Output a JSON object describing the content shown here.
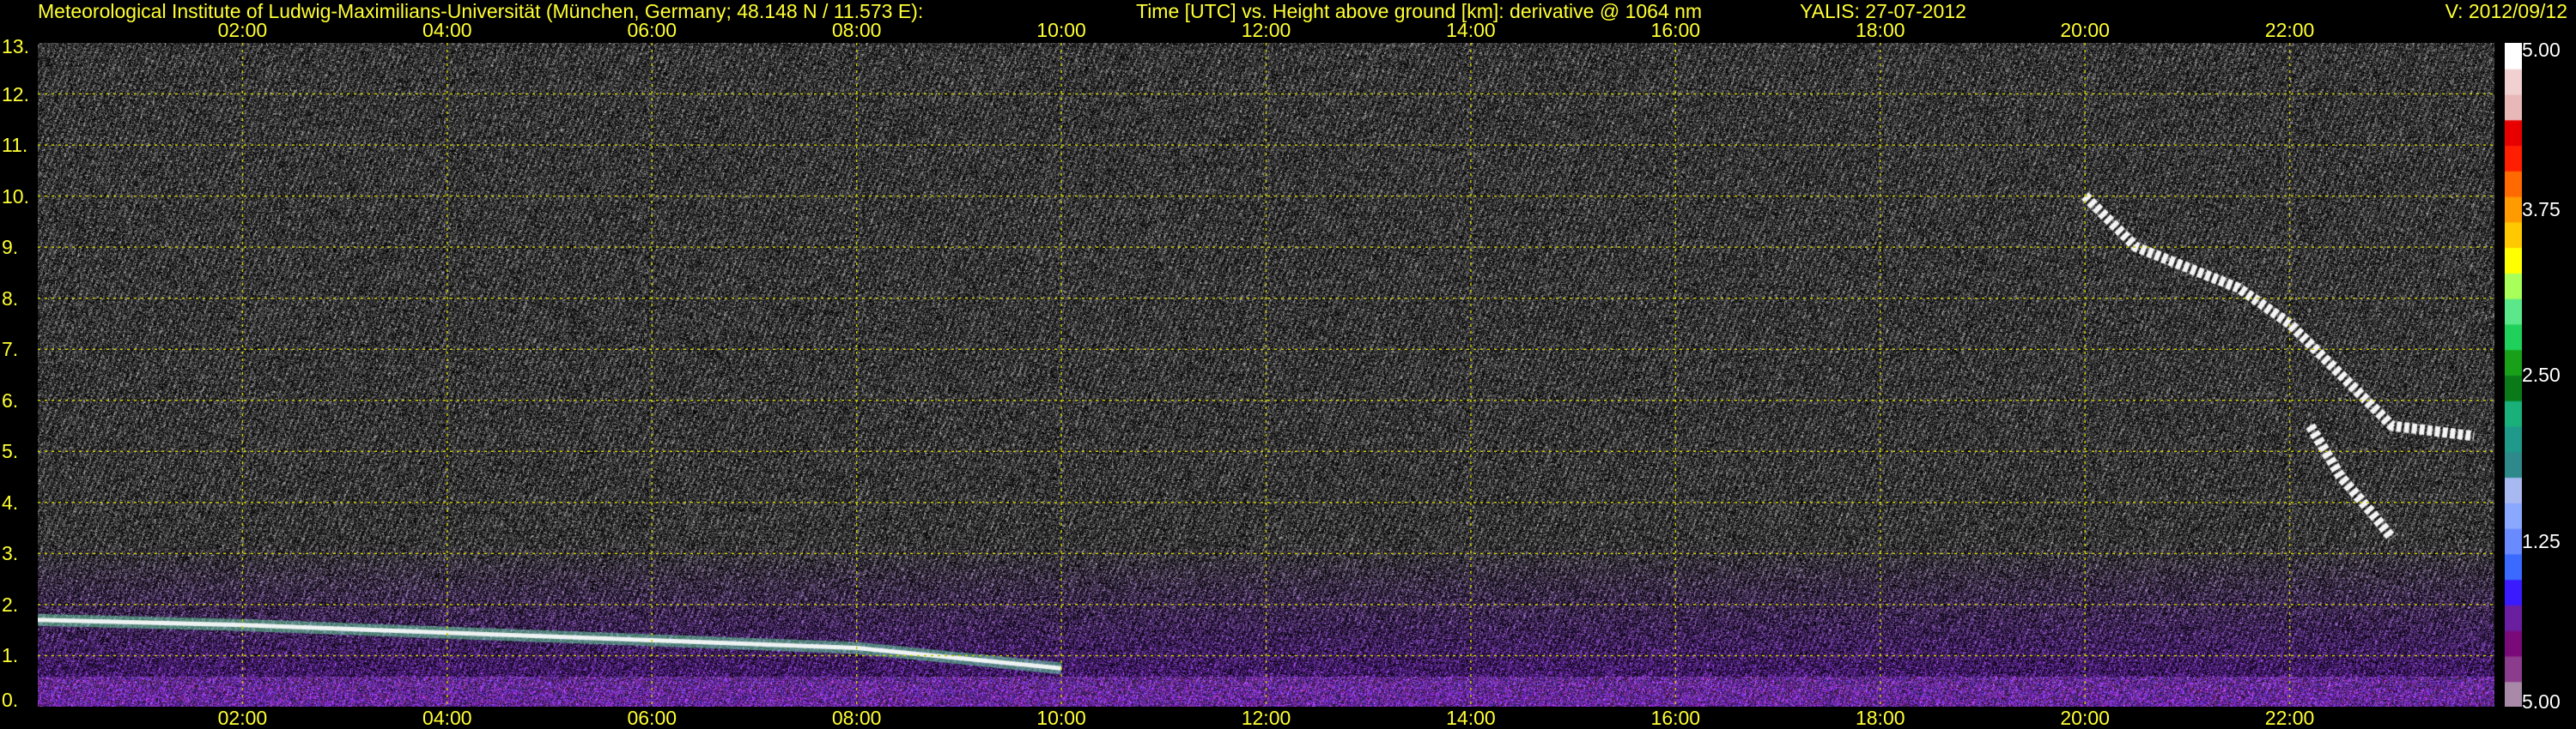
{
  "header": {
    "institute": "Meteorological Institute of Ludwig-Maximilians-Universität (München, Germany; 48.148 N / 11.573 E):",
    "title": "Time [UTC] vs. Height above ground [km]: derivative @ 1064 nm",
    "instrument": "YALIS: 27-07-2012",
    "version": "V: 2012/09/12"
  },
  "colors": {
    "text": "#ffff33",
    "grid": "#c8c800",
    "background": "#000000"
  },
  "chart_data": {
    "type": "heatmap",
    "title": "Time [UTC] vs. Height above ground [km]: derivative @ 1064 nm",
    "xlabel": "Time [UTC]",
    "ylabel": "Height above ground [km]",
    "xlim": [
      0,
      24
    ],
    "ylim": [
      0,
      13
    ],
    "x_ticks": [
      "02:00",
      "04:00",
      "06:00",
      "08:00",
      "10:00",
      "12:00",
      "14:00",
      "16:00",
      "18:00",
      "20:00",
      "22:00"
    ],
    "x_tick_values": [
      2,
      4,
      6,
      8,
      10,
      12,
      14,
      16,
      18,
      20,
      22
    ],
    "y_ticks": [
      "0.",
      "1.",
      "2.",
      "3.",
      "4.",
      "5.",
      "6.",
      "7.",
      "8.",
      "9.",
      "10.",
      "11.",
      "12.",
      "13."
    ],
    "y_tick_values": [
      0,
      1,
      2,
      3,
      4,
      5,
      6,
      7,
      8,
      9,
      10,
      11,
      12,
      13
    ],
    "grid": true,
    "colorbar": {
      "range": [
        0,
        5
      ],
      "ticks": [
        "5.00",
        "3.75",
        "2.50",
        "1.25",
        "5.00"
      ],
      "tick_values": [
        5,
        3.75,
        2.5,
        1.25,
        0
      ],
      "colors": [
        "#a889a8",
        "#8c3c8c",
        "#7a0a7a",
        "#6a1fa0",
        "#3a1aff",
        "#3a6aff",
        "#6a8aff",
        "#8aa8ff",
        "#a8b8f0",
        "#2e8a8a",
        "#1f9a8a",
        "#19b07a",
        "#0a7a19",
        "#19a019",
        "#1fd05a",
        "#5ae88a",
        "#a8ff5a",
        "#ffff00",
        "#ffc800",
        "#ff9a00",
        "#ff6a00",
        "#ff1f00",
        "#e80000",
        "#e8b8b8",
        "#f0d0d0",
        "#ffffff"
      ]
    },
    "features": [
      {
        "kind": "aerosol-layer-top",
        "x": [
          0.0,
          2.0,
          4.0,
          6.0,
          8.0,
          10.0
        ],
        "y": [
          1.7,
          1.6,
          1.45,
          1.3,
          1.15,
          0.75
        ]
      },
      {
        "kind": "cirrus-cloud",
        "x": [
          20.0,
          20.5,
          21.0,
          21.5,
          22.0,
          22.5,
          23.0,
          23.8
        ],
        "y": [
          10.0,
          9.0,
          8.6,
          8.2,
          7.5,
          6.5,
          5.5,
          5.3
        ]
      },
      {
        "kind": "cirrus-fall-streak",
        "x": [
          22.2,
          22.5,
          22.8,
          23.0
        ],
        "y": [
          5.5,
          4.5,
          3.8,
          3.3
        ]
      }
    ]
  }
}
